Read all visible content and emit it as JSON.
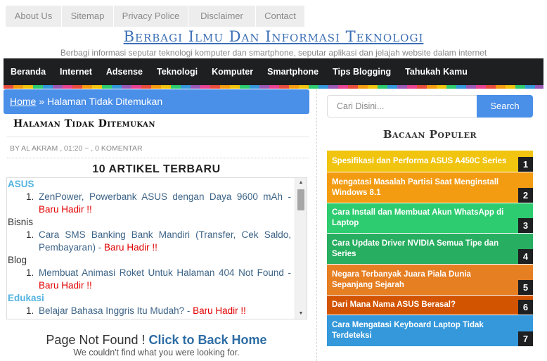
{
  "top_nav": [
    "About Us",
    "Sitemap",
    "Privacy Police",
    "Disclaimer",
    "Contact"
  ],
  "header": {
    "title": "Berbagi Ilmu Dan Informasi Teknologi",
    "description": "Berbagi informasi seputar teknologi komputer dan smartphone, seputar aplikasi dan jelajah website dalam internet"
  },
  "main_nav": [
    "Beranda",
    "Internet",
    "Adsense",
    "Teknologi",
    "Komputer",
    "Smartphone",
    "Tips Blogging",
    "Tahukah Kamu"
  ],
  "breadcrumb": {
    "home": "Home",
    "separator": " » ",
    "current": "Halaman Tidak Ditemukan"
  },
  "post": {
    "title": "Halaman Tidak Ditemukan",
    "meta": "BY AL AKRAM , 01:20 ~ , 0 KOMENTAR"
  },
  "recent": {
    "heading": "10 ARTIKEL TERBARU",
    "badge": "Baru Hadir !!",
    "separator": " - ",
    "groups": [
      {
        "category": "ASUS",
        "color": "#52b3e0",
        "items": [
          {
            "num": "1.",
            "title": "ZenPower, Powerbank ASUS dengan Daya 9600 mAh"
          }
        ]
      },
      {
        "category": "Bisnis",
        "color": "#333333",
        "items": [
          {
            "num": "1.",
            "title": "Cara SMS Banking Bank Mandiri (Transfer, Cek Saldo, Pembayaran)"
          }
        ]
      },
      {
        "category": "Blog",
        "color": "#333333",
        "items": [
          {
            "num": "1.",
            "title": "Membuat Animasi Roket Untuk Halaman 404 Not Found"
          }
        ]
      },
      {
        "category": "Edukasi",
        "color": "#52b3e0",
        "items": [
          {
            "num": "1.",
            "title": "Belajar Bahasa Inggris Itu Mudah?"
          }
        ]
      }
    ]
  },
  "not_found": {
    "text": "Page Not Found ! ",
    "link": "Click to Back Home",
    "sub": "We couldn't find what you were looking for."
  },
  "sidebar": {
    "search_placeholder": "Cari Disini...",
    "search_button": "Search",
    "popular_heading": "Bacaan Populer",
    "popular": [
      {
        "title": "Spesifikasi dan Performa ASUS A450C Series",
        "rank": "1",
        "color": "#f1c40f"
      },
      {
        "title": "Mengatasi Masalah Partisi Saat Menginstall Windows 8.1",
        "rank": "2",
        "color": "#f39c12"
      },
      {
        "title": "Cara Install dan Membuat Akun WhatsApp di Laptop",
        "rank": "3",
        "color": "#2ecc71"
      },
      {
        "title": "Cara Update Driver NVIDIA Semua Tipe dan Series",
        "rank": "4",
        "color": "#27ae60"
      },
      {
        "title": "Negara Terbanyak Juara Piala Dunia Sepanjang Sejarah",
        "rank": "5",
        "color": "#e67e22"
      },
      {
        "title": "Dari Mana Nama ASUS Berasal?",
        "rank": "6",
        "color": "#d35400"
      },
      {
        "title": "Cara Mengatasi Keyboard Laptop Tidak Terdeteksi",
        "rank": "7",
        "color": "#3498db"
      }
    ]
  }
}
